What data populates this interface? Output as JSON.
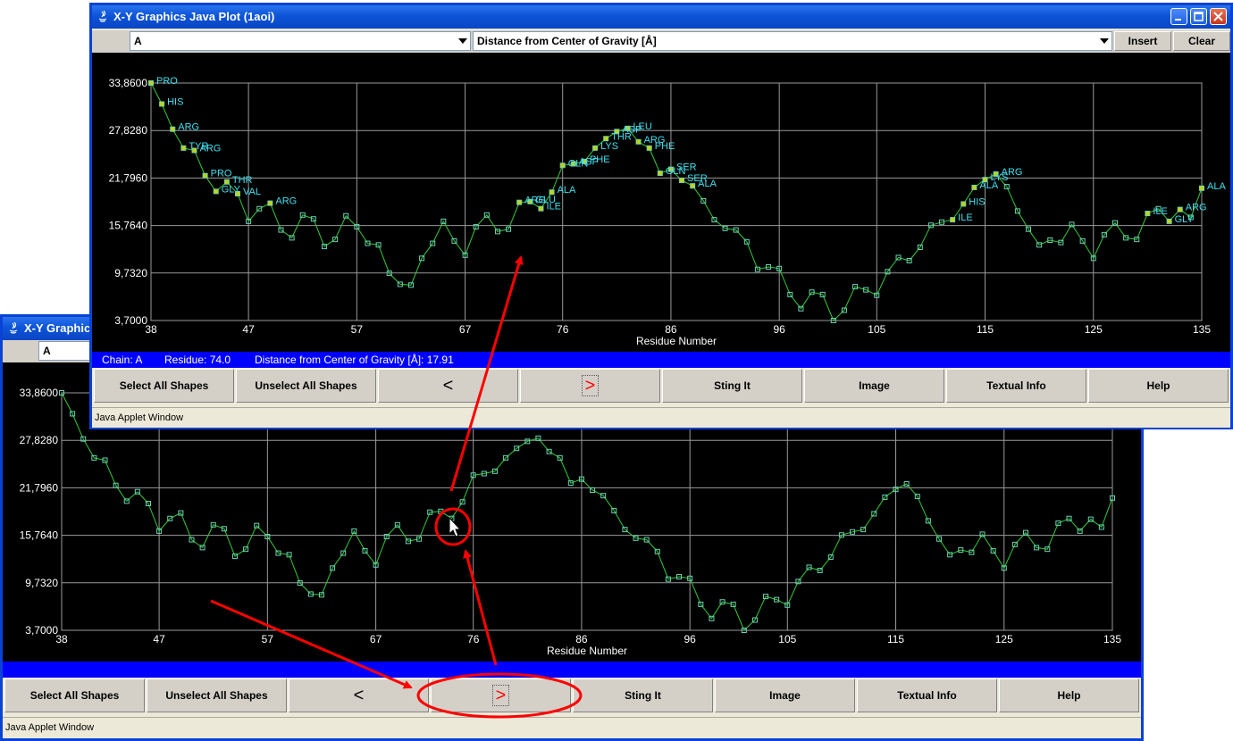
{
  "front_window": {
    "title": "X-Y Graphics Java Plot (1aoi)",
    "chain_select": "A",
    "metric_select": "Distance from Center of Gravity [Å]",
    "insert_label": "Insert",
    "clear_label": "Clear",
    "status": {
      "chain": "Chain: A",
      "residue": "Residue: 74.0",
      "distance": "Distance from Center of Gravity [Å]: 17.91"
    }
  },
  "back_window": {
    "title": "X-Y Graphics Java Plot (1aoi)",
    "title_visible": "X-Y Graphic",
    "chain_select": "A"
  },
  "buttons": {
    "select_all": "Select All Shapes",
    "unselect_all": "Unselect All Shapes",
    "prev": "<",
    "next": ">",
    "sting_it": "Sting It",
    "image": "Image",
    "textual_info": "Textual Info",
    "help": "Help"
  },
  "applet_status": "Java Applet Window",
  "colors": {
    "titlebar": "#0a46c4",
    "status_bar": "#0000ff",
    "plot_bg": "#000000",
    "line": "#32cd32",
    "point_outline": "#6ad2b8",
    "label": "#40e0f0",
    "annotation": "#ff0000"
  },
  "chart_data": {
    "type": "line",
    "xlabel": "Residue Number",
    "ylabel": "",
    "x_ticks": [
      "38",
      "47",
      "57",
      "67",
      "76",
      "86",
      "96",
      "105",
      "115",
      "125",
      "135"
    ],
    "y_ticks": [
      "3,7000",
      "9,7320",
      "15,7640",
      "21,7960",
      "27,8280",
      "33,8600"
    ],
    "xlim": [
      38,
      135
    ],
    "ylim": [
      3.7,
      33.86
    ],
    "x": [
      38,
      39,
      40,
      41,
      42,
      43,
      44,
      45,
      46,
      47,
      48,
      49,
      50,
      51,
      52,
      53,
      54,
      55,
      56,
      57,
      58,
      59,
      60,
      61,
      62,
      63,
      64,
      65,
      66,
      67,
      68,
      69,
      70,
      71,
      72,
      73,
      74,
      75,
      76,
      77,
      78,
      79,
      80,
      81,
      82,
      83,
      84,
      85,
      86,
      87,
      88,
      89,
      90,
      91,
      92,
      93,
      94,
      95,
      96,
      97,
      98,
      99,
      100,
      101,
      102,
      103,
      104,
      105,
      106,
      107,
      108,
      109,
      110,
      111,
      112,
      113,
      114,
      115,
      116,
      117,
      118,
      119,
      120,
      121,
      122,
      123,
      124,
      125,
      126,
      127,
      128,
      129,
      130,
      131,
      132,
      133,
      134,
      135
    ],
    "y": [
      33.86,
      31.2,
      28.0,
      25.6,
      25.3,
      22.1,
      20.1,
      21.3,
      19.8,
      16.3,
      17.9,
      18.6,
      15.2,
      14.2,
      17.1,
      16.6,
      13.1,
      14.0,
      17.0,
      15.6,
      13.5,
      13.3,
      9.7,
      8.3,
      8.2,
      11.6,
      13.5,
      16.3,
      13.8,
      12.0,
      15.6,
      17.1,
      15.0,
      15.3,
      18.7,
      18.8,
      17.91,
      20.0,
      23.4,
      23.6,
      23.9,
      25.6,
      26.8,
      27.7,
      28.1,
      26.4,
      25.6,
      22.4,
      22.9,
      21.5,
      20.8,
      18.9,
      16.5,
      15.4,
      15.2,
      13.7,
      10.2,
      10.5,
      10.3,
      7.0,
      5.2,
      7.3,
      7.0,
      3.7,
      5.0,
      8.0,
      7.6,
      6.9,
      9.9,
      11.7,
      11.3,
      13.0,
      15.8,
      16.2,
      16.5,
      18.5,
      20.6,
      21.6,
      22.3,
      20.7,
      17.6,
      15.3,
      13.3,
      13.9,
      13.6,
      15.9,
      13.8,
      11.6,
      14.6,
      16.1,
      14.2,
      14.0,
      17.3,
      17.9,
      16.3,
      17.8,
      16.8,
      20.5
    ],
    "labels": [
      {
        "x": 38,
        "text": "PRO"
      },
      {
        "x": 39,
        "text": "HIS"
      },
      {
        "x": 40,
        "text": "ARG"
      },
      {
        "x": 41,
        "text": "TYR"
      },
      {
        "x": 42,
        "text": "ARG"
      },
      {
        "x": 43,
        "text": "PRO"
      },
      {
        "x": 45,
        "text": "THR"
      },
      {
        "x": 44,
        "text": "GLY"
      },
      {
        "x": 46,
        "text": "VAL"
      },
      {
        "x": 49,
        "text": "ARG"
      },
      {
        "x": 72,
        "text": "ARG"
      },
      {
        "x": 73,
        "text": "GLU"
      },
      {
        "x": 74,
        "text": "ILE"
      },
      {
        "x": 75,
        "text": "ALA"
      },
      {
        "x": 76,
        "text": "GLN"
      },
      {
        "x": 77,
        "text": "ASP"
      },
      {
        "x": 78,
        "text": "PHE"
      },
      {
        "x": 79,
        "text": "LYS"
      },
      {
        "x": 80,
        "text": "THR"
      },
      {
        "x": 81,
        "text": "ASP"
      },
      {
        "x": 82,
        "text": "LEU"
      },
      {
        "x": 83,
        "text": "ARG"
      },
      {
        "x": 84,
        "text": "PHE"
      },
      {
        "x": 85,
        "text": "GLN"
      },
      {
        "x": 86,
        "text": "SER"
      },
      {
        "x": 87,
        "text": "SER"
      },
      {
        "x": 88,
        "text": "ALA"
      },
      {
        "x": 112,
        "text": "ILE"
      },
      {
        "x": 113,
        "text": "HIS"
      },
      {
        "x": 114,
        "text": "ALA"
      },
      {
        "x": 115,
        "text": "LYS"
      },
      {
        "x": 116,
        "text": "ARG"
      },
      {
        "x": 130,
        "text": "ILE"
      },
      {
        "x": 132,
        "text": "GLY"
      },
      {
        "x": 133,
        "text": "ARG"
      },
      {
        "x": 135,
        "text": "ALA"
      }
    ],
    "grid": true
  }
}
